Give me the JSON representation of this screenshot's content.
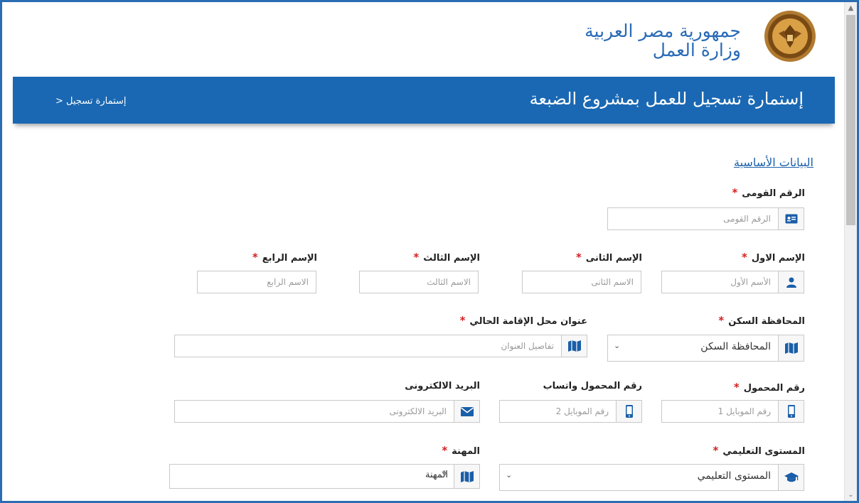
{
  "header": {
    "org_line1": "جمهورية مصر العربية",
    "org_line2": "وزارة العمل",
    "logo_text": "Ministry Of Labour"
  },
  "banner": {
    "title": "إستمارة تسجيل للعمل بمشروع الضبعة",
    "breadcrumb": "> إستمارة تسجيل"
  },
  "section": {
    "basic_info": "البيانات الأساسية"
  },
  "form": {
    "national_id": {
      "label": "الرقم القومى",
      "placeholder": "الرقم القومى",
      "required": true,
      "icon": "id-card-icon"
    },
    "first_name": {
      "label": "الإسم الاول",
      "placeholder": "الأسم الأول",
      "required": true,
      "icon": "user-icon"
    },
    "second_name": {
      "label": "الإسم الثانى",
      "placeholder": "الاسم الثانى",
      "required": true
    },
    "third_name": {
      "label": "الإسم الثالث",
      "placeholder": "الاسم الثالث",
      "required": true
    },
    "fourth_name": {
      "label": "الإسم الرابع",
      "placeholder": "الاسم الرابع",
      "required": true
    },
    "governorate": {
      "label": "المحافظة السكن",
      "value": "المحافظة السكن",
      "required": true,
      "icon": "map-icon"
    },
    "address": {
      "label": "عنوان محل الإقامة الحالي",
      "placeholder": "تفاصيل العنوان",
      "required": true,
      "icon": "map-icon"
    },
    "mobile": {
      "label": "رقم المحمول",
      "placeholder": "رقم الموبايل 1",
      "required": true,
      "icon": "mobile-icon"
    },
    "whatsapp": {
      "label": "رقم المحمول واتساب",
      "placeholder": "رقم الموبايل 2",
      "icon": "mobile-icon"
    },
    "email": {
      "label": "البريد الالكترونى",
      "placeholder": "البريد الالكترونى",
      "icon": "envelope-icon"
    },
    "education": {
      "label": "المستوى التعليمي",
      "value": "المستوى التعليمي",
      "required": true,
      "icon": "graduation-cap-icon"
    },
    "profession": {
      "label": "المهنة",
      "value": "المهنة",
      "required": true,
      "icon": "map-icon"
    }
  },
  "colors": {
    "brand": "#1a68b3",
    "accent_icon": "#1a5ea8",
    "required": "#d42020"
  }
}
